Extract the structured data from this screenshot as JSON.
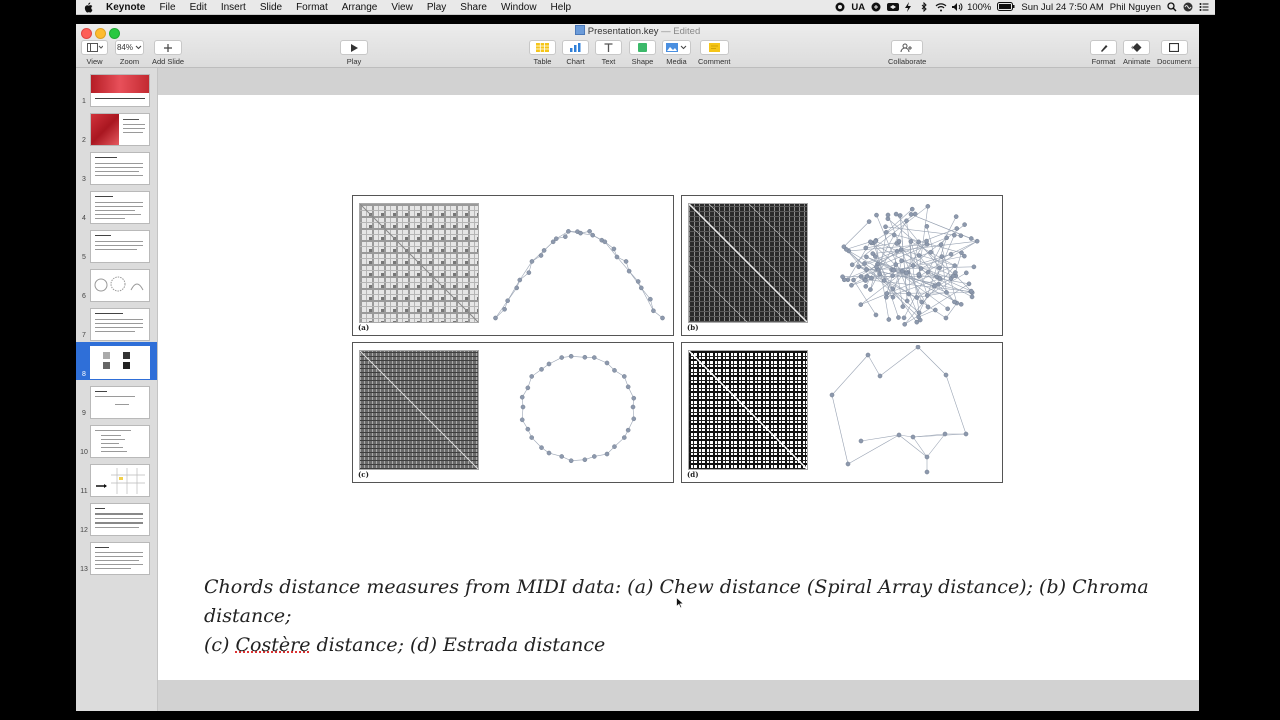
{
  "menubar": {
    "app_name": "Keynote",
    "items": [
      "File",
      "Edit",
      "Insert",
      "Slide",
      "Format",
      "Arrange",
      "View",
      "Play",
      "Share",
      "Window",
      "Help"
    ],
    "input_source": "UA",
    "battery": "100%",
    "datetime": "Sun Jul 24  7:50 AM",
    "user": "Phil Nguyen"
  },
  "window": {
    "title": "Presentation.key",
    "title_status": "— Edited"
  },
  "toolbar": {
    "view_label": "View",
    "zoom_label": "Zoom",
    "zoom_value": "84%",
    "add_slide_label": "Add Slide",
    "play_label": "Play",
    "table_label": "Table",
    "chart_label": "Chart",
    "text_label": "Text",
    "shape_label": "Shape",
    "media_label": "Media",
    "comment_label": "Comment",
    "collaborate_label": "Collaborate",
    "format_label": "Format",
    "animate_label": "Animate",
    "document_label": "Document"
  },
  "navigator": {
    "slide_numbers": [
      "1",
      "2",
      "3",
      "4",
      "5",
      "6",
      "7",
      "8",
      "9",
      "10",
      "11",
      "12",
      "13"
    ],
    "selected_index": 8
  },
  "slide": {
    "panels": [
      {
        "label": "(a)"
      },
      {
        "label": "(b)"
      },
      {
        "label": "(c)"
      },
      {
        "label": "(d)"
      }
    ],
    "caption_line1": "Chords distance measures from MIDI data: (a) Chew distance (Spiral Array distance); (b) Chroma distance;",
    "caption_line2_prefix": "(c) ",
    "caption_line2_underlined": "Costère",
    "caption_line2_suffix": " distance; (d) Estrada distance"
  },
  "colors": {
    "selection": "#2f6fd8",
    "node": "#8d99ad"
  }
}
